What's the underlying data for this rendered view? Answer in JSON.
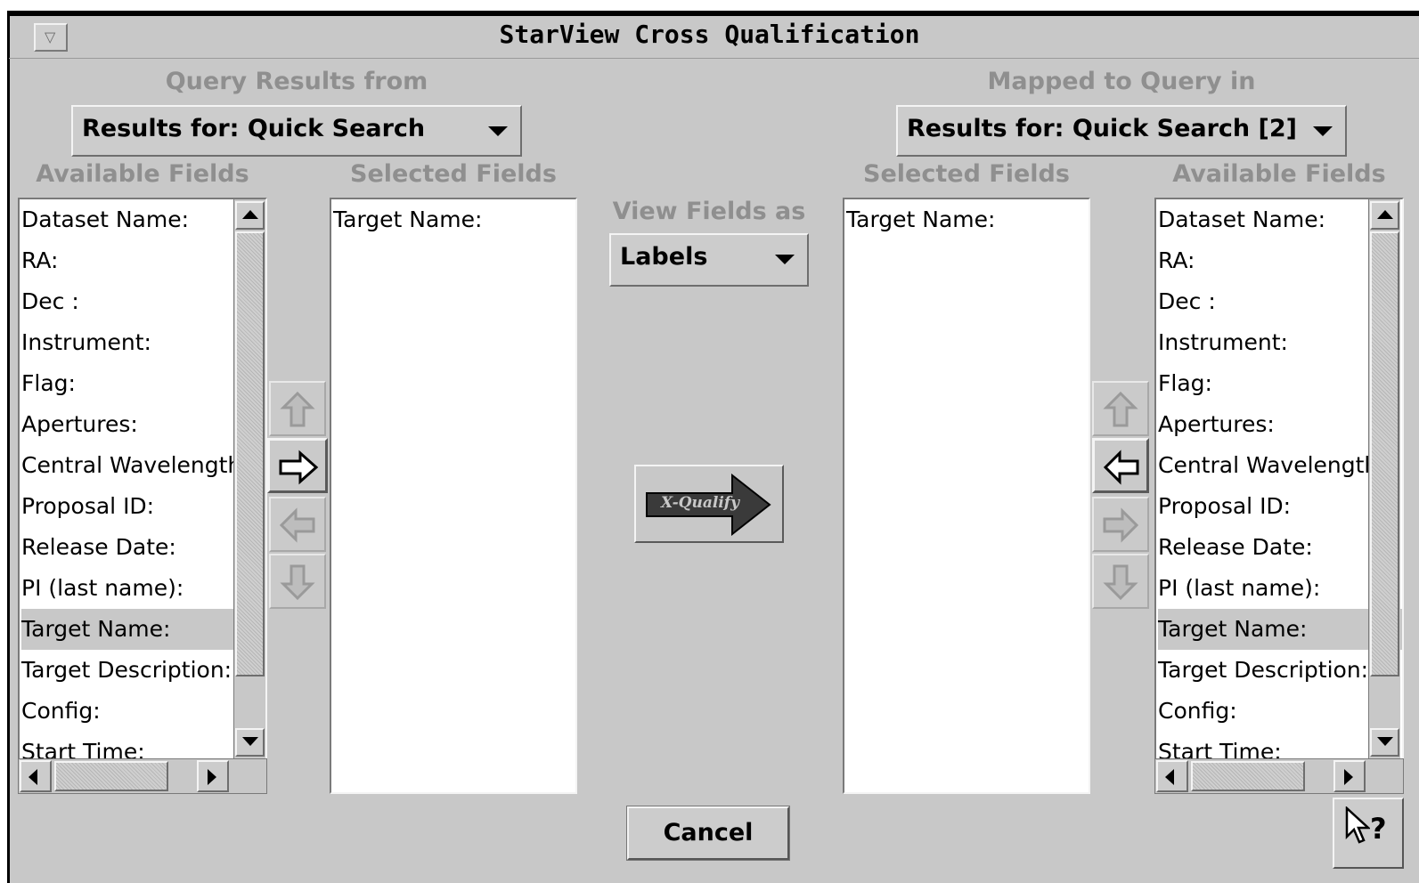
{
  "window": {
    "title": "StarView Cross Qualification",
    "menu_glyph": "▽"
  },
  "left": {
    "group_label": "Query Results from",
    "source_value": "Results for: Quick Search",
    "available_label": "Available Fields",
    "selected_label": "Selected Fields",
    "available": [
      "Dataset Name:",
      "RA:",
      "Dec :",
      "Instrument:",
      "Flag:",
      "Apertures:",
      "Central Wavelength:",
      "Proposal ID:",
      "Release Date:",
      "PI (last name):",
      "Target Name:",
      "Target Description:",
      "Config:",
      "Start Time:"
    ],
    "selected_index": 10,
    "selected": [
      "Target Name:"
    ]
  },
  "center": {
    "view_label": "View Fields as",
    "view_value": "Labels",
    "xqualify_label": "X-Qualify",
    "cancel_label": "Cancel"
  },
  "right": {
    "group_label": "Mapped to Query in",
    "target_value": "Results for: Quick Search [2]",
    "selected_label": "Selected Fields",
    "available_label": "Available Fields",
    "available": [
      "Dataset Name:",
      "RA:",
      "Dec :",
      "Instrument:",
      "Flag:",
      "Apertures:",
      "Central Wavelength:",
      "Proposal ID:",
      "Release Date:",
      "PI (last name):",
      "Target Name:",
      "Target Description:",
      "Config:",
      "Start Time:"
    ],
    "selected_index": 10,
    "selected": [
      "Target Name:"
    ]
  },
  "help": {
    "glyph": "?"
  },
  "colors": {
    "background": "#c8c8c8",
    "disabled_label": "#8f8f8f",
    "active_arrow": "#000000",
    "disabled_arrow": "#9a9a9a"
  },
  "icons": {
    "move_up": "arrow-up-icon",
    "move_right": "arrow-right-icon",
    "move_left": "arrow-left-icon",
    "move_down": "arrow-down-icon",
    "xqualify": "xqualify-arrow-icon",
    "help": "help-pointer-icon"
  }
}
